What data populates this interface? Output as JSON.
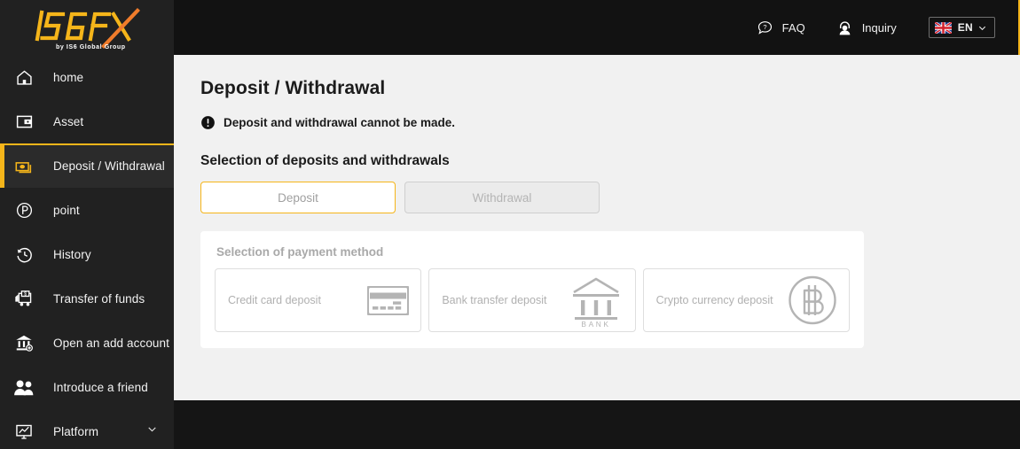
{
  "brand": {
    "logo_text": "IS6FX",
    "logo_tagline": "by IS6 Global Group",
    "accent_color": "#f5b51a",
    "accent_orange": "#f07c2b",
    "sidebar_bg": "#212121",
    "header_bg": "#121212",
    "page_bg": "#f1f1f1"
  },
  "header": {
    "faq_label": "FAQ",
    "faq_icon": "question-speech-bubble-icon",
    "inquiry_label": "Inquiry",
    "inquiry_icon": "headset-person-icon",
    "language_code": "EN",
    "language_flag": "uk-flag-icon",
    "language_chevron": "chevron-down-icon"
  },
  "sidebar": {
    "items": [
      {
        "label": "home",
        "icon": "home-icon",
        "active": false
      },
      {
        "label": "Asset",
        "icon": "wallet-icon",
        "active": false
      },
      {
        "label": "Deposit / Withdrawal",
        "icon": "banknotes-icon",
        "active": true
      },
      {
        "label": "point",
        "icon": "point-circle-p-icon",
        "active": false
      },
      {
        "label": "History",
        "icon": "clock-rewind-icon",
        "active": false
      },
      {
        "label": "Transfer of funds",
        "icon": "money-truck-icon",
        "active": false
      },
      {
        "label": "Open an add account",
        "icon": "bank-plus-icon",
        "active": false
      },
      {
        "label": "Introduce a friend",
        "icon": "two-people-icon",
        "active": false
      },
      {
        "label": "Platform",
        "icon": "monitor-chart-icon",
        "active": false,
        "chevron": "chevron-down-icon"
      }
    ]
  },
  "main": {
    "page_title": "Deposit / Withdrawal",
    "notice_icon": "exclamation-circle-icon",
    "notice_text": "Deposit and withdrawal cannot be made.",
    "section_title": "Selection of deposits and withdrawals",
    "toggle": {
      "deposit_label": "Deposit",
      "withdrawal_label": "Withdrawal",
      "selected": "Deposit"
    },
    "panel": {
      "title": "Selection of payment method",
      "cards": [
        {
          "label": "Credit card deposit",
          "icon": "credit-card-icon"
        },
        {
          "label": "Bank transfer deposit",
          "icon": "bank-building-icon",
          "icon_caption": "BANK"
        },
        {
          "label": "Crypto currency deposit",
          "icon": "bitcoin-circle-icon"
        }
      ]
    }
  }
}
